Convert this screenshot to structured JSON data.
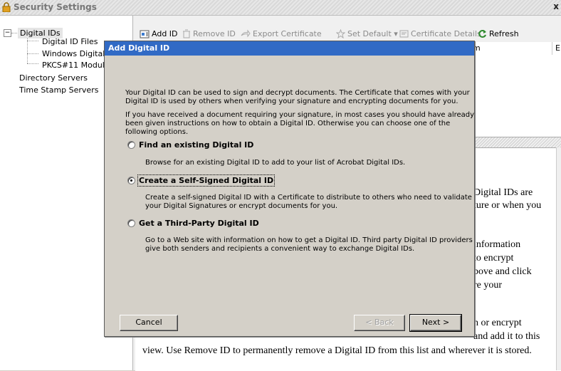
{
  "window": {
    "title": "Security Settings",
    "close_glyph": "x"
  },
  "tree": {
    "expander_glyph": "−",
    "items": [
      {
        "label": "Digital IDs"
      },
      {
        "label": "Digital ID Files"
      },
      {
        "label": "Windows Digital"
      },
      {
        "label": "PKCS#11 Modul"
      },
      {
        "label": "Directory Servers"
      },
      {
        "label": "Time Stamp Servers"
      }
    ]
  },
  "toolbar": {
    "add_id": "Add ID",
    "remove_id": "Remove ID",
    "export_certificate": "Export Certificate",
    "set_default": "Set Default ▾",
    "certificate_details": "Certificate Details",
    "refresh": "Refresh"
  },
  "list": {
    "col_name_fragment": "m",
    "col_expires_fragment": "E"
  },
  "background_text": [
    "Digital IDs are",
    "ture or when you",
    "information",
    "to encrypt",
    "bove and click",
    "re your",
    "n or encrypt",
    "and add it to this",
    "view. Use Remove ID to permanently remove a Digital ID from this list and wherever it is stored."
  ],
  "dialog": {
    "title": "Add Digital ID",
    "intro1_line1": "Your Digital ID can be used to sign and decrypt documents. The Certificate that comes with your",
    "intro1_line2": "Digital ID is used by others when verifying your signature and encrypting documents for you.",
    "intro2_line1": "If you have received a document requiring your signature, in most cases you should have already",
    "intro2_line2": "been given instructions on how to obtain a Digital ID. Otherwise you can choose one of the",
    "intro2_line3": "following options.",
    "options": [
      {
        "label": "Find an existing Digital ID",
        "desc1": "Browse for an existing Digital ID to add to your list of Acrobat Digital IDs.",
        "desc2": "",
        "selected": false
      },
      {
        "label": "Create a Self-Signed Digital ID",
        "desc1": "Create a self-signed Digital ID with a Certificate to distribute to others who need to validate",
        "desc2": "your Digital Signatures or encrypt documents for you.",
        "selected": true
      },
      {
        "label": "Get a Third-Party Digital ID",
        "desc1": "Go to a Web site with information on how to get a Digital ID. Third party Digital ID providers",
        "desc2": "give both senders and recipients a convenient way to exchange Digital IDs.",
        "selected": false
      }
    ],
    "cancel": "Cancel",
    "back": "< Back",
    "next": "Next >"
  }
}
